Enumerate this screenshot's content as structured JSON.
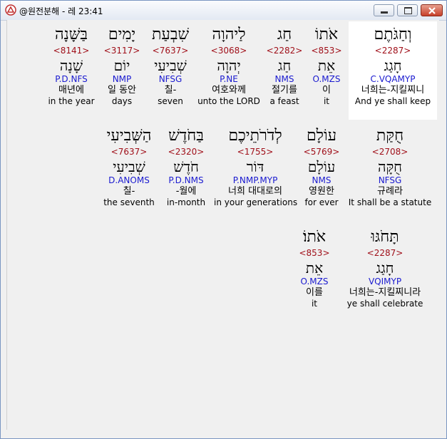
{
  "window": {
    "title": "@원전분해 - 레 23:41"
  },
  "rows": [
    [
      {
        "heb": "וְחַגֹּתֶם",
        "num": "<2287>",
        "lemma": "חָגַג",
        "morph": "C.VQAMYP",
        "kor": "너희는-지킬찌니",
        "eng": "And ye shall keep",
        "hl": true
      },
      {
        "heb": "אֹתוֹ",
        "num": "<853>",
        "lemma": "אֵת",
        "morph": "O.MZS",
        "kor": "이",
        "eng": "it"
      },
      {
        "heb": "חַג",
        "num": "<2282>",
        "lemma": "חַג",
        "morph": "NMS",
        "kor": "절기를",
        "eng": "a feast"
      },
      {
        "heb": "לַיהוָה",
        "num": "<3068>",
        "lemma": "יְהוָה",
        "morph": "P.NE",
        "kor": "여호와께",
        "eng": "unto the LORD"
      },
      {
        "heb": "שִׁבְעַת",
        "num": "<7637>",
        "lemma": "שְׁבִיעִי",
        "morph": "NFSG",
        "kor": "칠-",
        "eng": "seven"
      },
      {
        "heb": "יָמִים",
        "num": "<3117>",
        "lemma": "יוֹם",
        "morph": "NMP",
        "kor": "일 동안",
        "eng": "days"
      },
      {
        "heb": "בַּשָּׁנָה",
        "num": "<8141>",
        "lemma": "שָׁנָה",
        "morph": "P.D.NFS",
        "kor": "매년에",
        "eng": "in the year"
      }
    ],
    [
      {
        "heb": "חֻקַּת",
        "num": "<2708>",
        "lemma": "חֻקָּה",
        "morph": "NFSG",
        "kor": "규례라",
        "eng": "It shall be a statute"
      },
      {
        "heb": "עוֹלָם",
        "num": "<5769>",
        "lemma": "עוֹלָם",
        "morph": "NMS",
        "kor": "영원한",
        "eng": "for ever"
      },
      {
        "heb": "לְדֹרֹתֵיכֶם",
        "num": "<1755>",
        "lemma": "דּוֹר",
        "morph": "P.NMP.MYP",
        "kor": "너희 대대로의",
        "eng": "in your generations"
      },
      {
        "heb": "בַּחֹדֶשׁ",
        "num": "<2320>",
        "lemma": "חֹדֶשׁ",
        "morph": "P.D.NMS",
        "kor": "-월에",
        "eng": "in-month"
      },
      {
        "heb": "הַשְּׁבִיעִי",
        "num": "<7637>",
        "lemma": "שְׁבִיעִי",
        "morph": "D.ANOMS",
        "kor": "칠-",
        "eng": "the seventh"
      }
    ],
    [
      {
        "heb": "תָּחֹגּוּ",
        "num": "<2287>",
        "lemma": "חָגַג",
        "morph": "VQIMYP",
        "kor": "너희는-지킬찌니라",
        "eng": "ye shall celebrate"
      },
      {
        "heb": "אֹתוֹ׃",
        "num": "<853>",
        "lemma": "אֵת",
        "morph": "O.MZS",
        "kor": "이를",
        "eng": "it"
      }
    ]
  ]
}
